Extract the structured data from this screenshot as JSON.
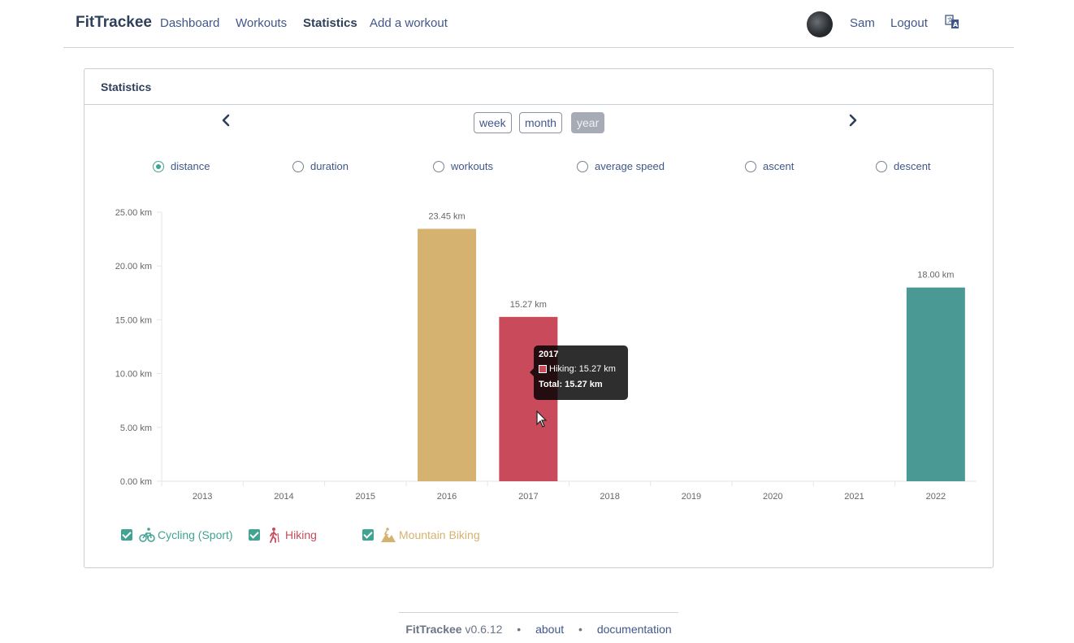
{
  "nav": {
    "brand": "FitTrackee",
    "links": [
      "Dashboard",
      "Workouts",
      "Statistics",
      "Add a workout"
    ],
    "user": "Sam",
    "logout": "Logout",
    "language_icon": "translate-icon"
  },
  "card": {
    "title": "Statistics",
    "periods": [
      "week",
      "month",
      "year"
    ],
    "selected_period": "year",
    "metrics": [
      "distance",
      "duration",
      "workouts",
      "average speed",
      "ascent",
      "descent"
    ],
    "selected_metric": "distance"
  },
  "chart_data": {
    "type": "bar",
    "stacked": true,
    "categories": [
      "2013",
      "2014",
      "2015",
      "2016",
      "2017",
      "2018",
      "2019",
      "2020",
      "2021",
      "2022"
    ],
    "series": [
      {
        "name": "Cycling (Sport)",
        "color": "#4a9994",
        "values": [
          0,
          0,
          0,
          0,
          0,
          0,
          0,
          0,
          0,
          18.0
        ]
      },
      {
        "name": "Hiking",
        "color": "#c94b5b",
        "values": [
          0,
          0,
          0,
          0,
          15.27,
          0,
          0,
          0,
          0,
          0
        ]
      },
      {
        "name": "Mountain Biking",
        "color": "#d5b26f",
        "values": [
          0,
          0,
          0,
          23.45,
          0,
          0,
          0,
          0,
          0,
          0
        ]
      }
    ],
    "totals_labels": {
      "2016": "23.45 km",
      "2017": "15.27 km",
      "2022": "18.00 km"
    },
    "yticks": [
      "0.00 km",
      "5.00 km",
      "10.00 km",
      "15.00 km",
      "20.00 km",
      "25.00 km"
    ],
    "ylim": [
      0,
      25
    ],
    "grid": false
  },
  "tooltip": {
    "title": "2017",
    "line": "Hiking: 15.27 km",
    "total": "Total: 15.27 km"
  },
  "legend": {
    "items": [
      {
        "label": "Cycling (Sport)",
        "color": "#41a392",
        "icon": "cycling-icon"
      },
      {
        "label": "Hiking",
        "color": "#c94b5b",
        "icon": "hiking-icon"
      },
      {
        "label": "Mountain Biking",
        "color": "#d5b26f",
        "icon": "mountain-biking-icon"
      }
    ]
  },
  "footer": {
    "brand": "FitTrackee",
    "version": "v0.6.12",
    "separator": "•",
    "about": "about",
    "documentation": "documentation"
  }
}
